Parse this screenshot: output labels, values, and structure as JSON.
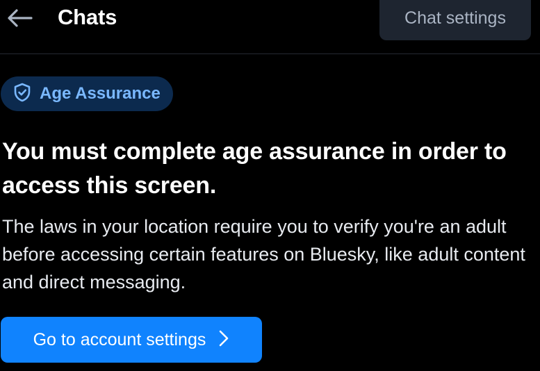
{
  "header": {
    "title": "Chats",
    "back_icon": "arrow-left-icon",
    "settings_label": "Chat settings"
  },
  "badge": {
    "icon": "shield-check-icon",
    "label": "Age Assurance"
  },
  "main": {
    "heading": "You must complete age assurance in order to access this screen.",
    "body": "The laws in your location require you to verify you're an adult before accessing certain features on Bluesky, like adult content and direct messaging.",
    "cta_label": "Go to account settings",
    "cta_icon": "chevron-right-icon"
  },
  "colors": {
    "background": "#000000",
    "primary": "#1083fe",
    "badge_bg": "#0c2a4e",
    "badge_text": "#7ab8ff",
    "secondary_button_bg": "#1e2530",
    "secondary_button_text": "#aab4c3"
  }
}
